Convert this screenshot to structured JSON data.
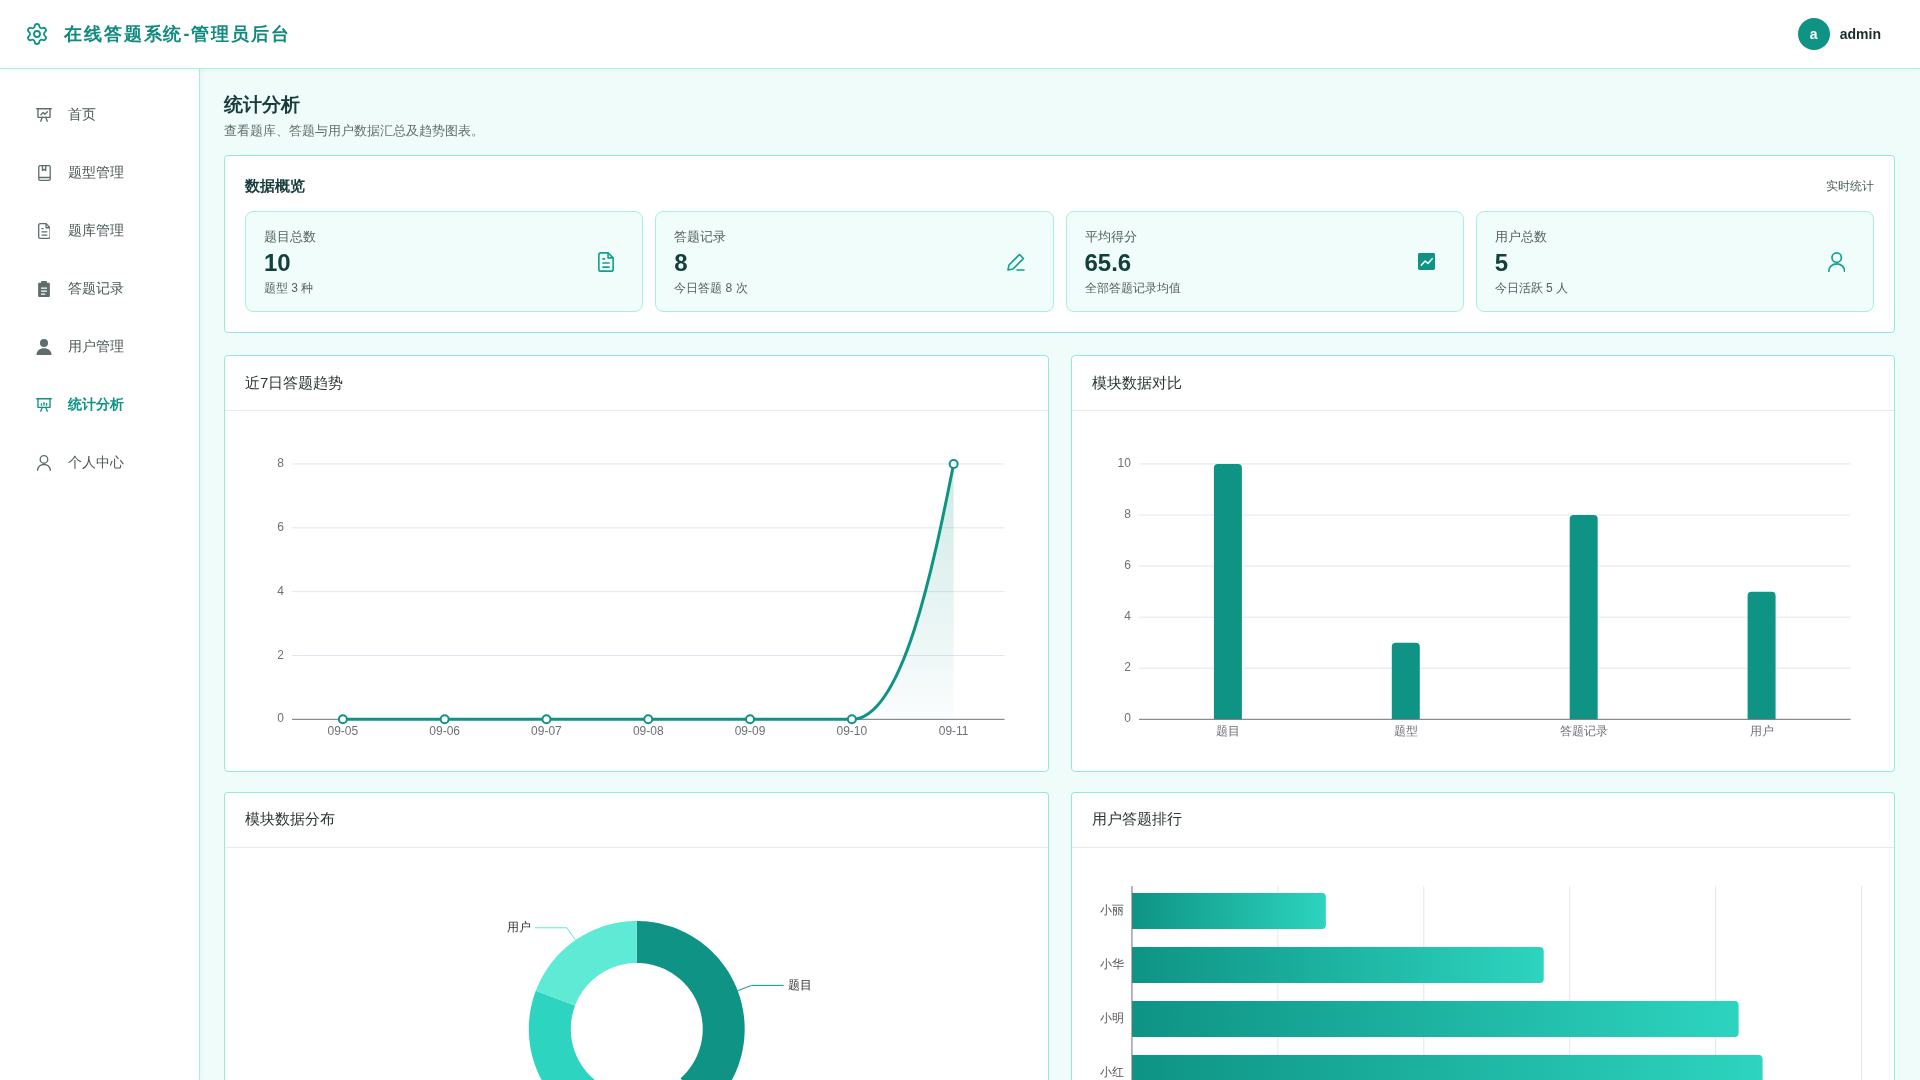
{
  "header": {
    "title": "在线答题系统-管理员后台",
    "user": {
      "initial": "a",
      "name": "admin"
    }
  },
  "sidebar": {
    "items": [
      {
        "label": "首页",
        "selected": false
      },
      {
        "label": "题型管理",
        "selected": false
      },
      {
        "label": "题库管理",
        "selected": false
      },
      {
        "label": "答题记录",
        "selected": false
      },
      {
        "label": "用户管理",
        "selected": false
      },
      {
        "label": "统计分析",
        "selected": true
      },
      {
        "label": "个人中心",
        "selected": false
      }
    ]
  },
  "page": {
    "title": "统计分析",
    "subtitle": "查看题库、答题与用户数据汇总及趋势图表。"
  },
  "overview": {
    "title": "数据概览",
    "tag": "实时统计",
    "stats": [
      {
        "label": "题目总数",
        "value": "10",
        "note": "题型 3 种"
      },
      {
        "label": "答题记录",
        "value": "8",
        "note": "今日答题 8 次"
      },
      {
        "label": "平均得分",
        "value": "65.6",
        "note": "全部答题记录均值"
      },
      {
        "label": "用户总数",
        "value": "5",
        "note": "今日活跃 5 人"
      }
    ]
  },
  "trend_panel": {
    "title": "近7日答题趋势",
    "chart_data": {
      "type": "area",
      "categories": [
        "09-05",
        "09-06",
        "09-07",
        "09-08",
        "09-09",
        "09-10",
        "09-11"
      ],
      "values": [
        0,
        0,
        0,
        0,
        0,
        0,
        8
      ],
      "ylim": [
        0,
        8
      ],
      "yticks": [
        0,
        2,
        4,
        6,
        8
      ],
      "grid": true
    }
  },
  "module_panel": {
    "title": "模块数据对比",
    "chart_data": {
      "type": "bar",
      "categories": [
        "题目",
        "题型",
        "答题记录",
        "用户"
      ],
      "values": [
        10,
        3,
        8,
        5
      ],
      "ylim": [
        0,
        10
      ],
      "yticks": [
        0,
        2,
        4,
        6,
        8,
        10
      ],
      "grid": true
    }
  },
  "distribution_panel": {
    "title": "模块数据分布",
    "slice_labels": [
      "用户",
      "题目"
    ]
  },
  "ranking_panel": {
    "title": "用户答题排行",
    "users": [
      "小丽",
      "小华",
      "小明",
      "小红"
    ]
  }
}
